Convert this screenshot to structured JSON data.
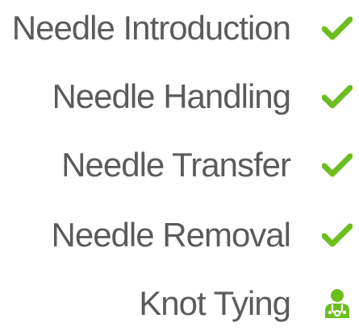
{
  "accent_color": "#6cbe1e",
  "text_color": "#5b5b5b",
  "tasks": [
    {
      "label": "Needle Introduction",
      "status": "complete",
      "icon": "checkmark-icon"
    },
    {
      "label": "Needle Handling",
      "status": "complete",
      "icon": "checkmark-icon"
    },
    {
      "label": "Needle Transfer",
      "status": "complete",
      "icon": "checkmark-icon"
    },
    {
      "label": "Needle Removal",
      "status": "complete",
      "icon": "checkmark-icon"
    },
    {
      "label": "Knot Tying",
      "status": "current",
      "icon": "doctor-icon"
    }
  ]
}
